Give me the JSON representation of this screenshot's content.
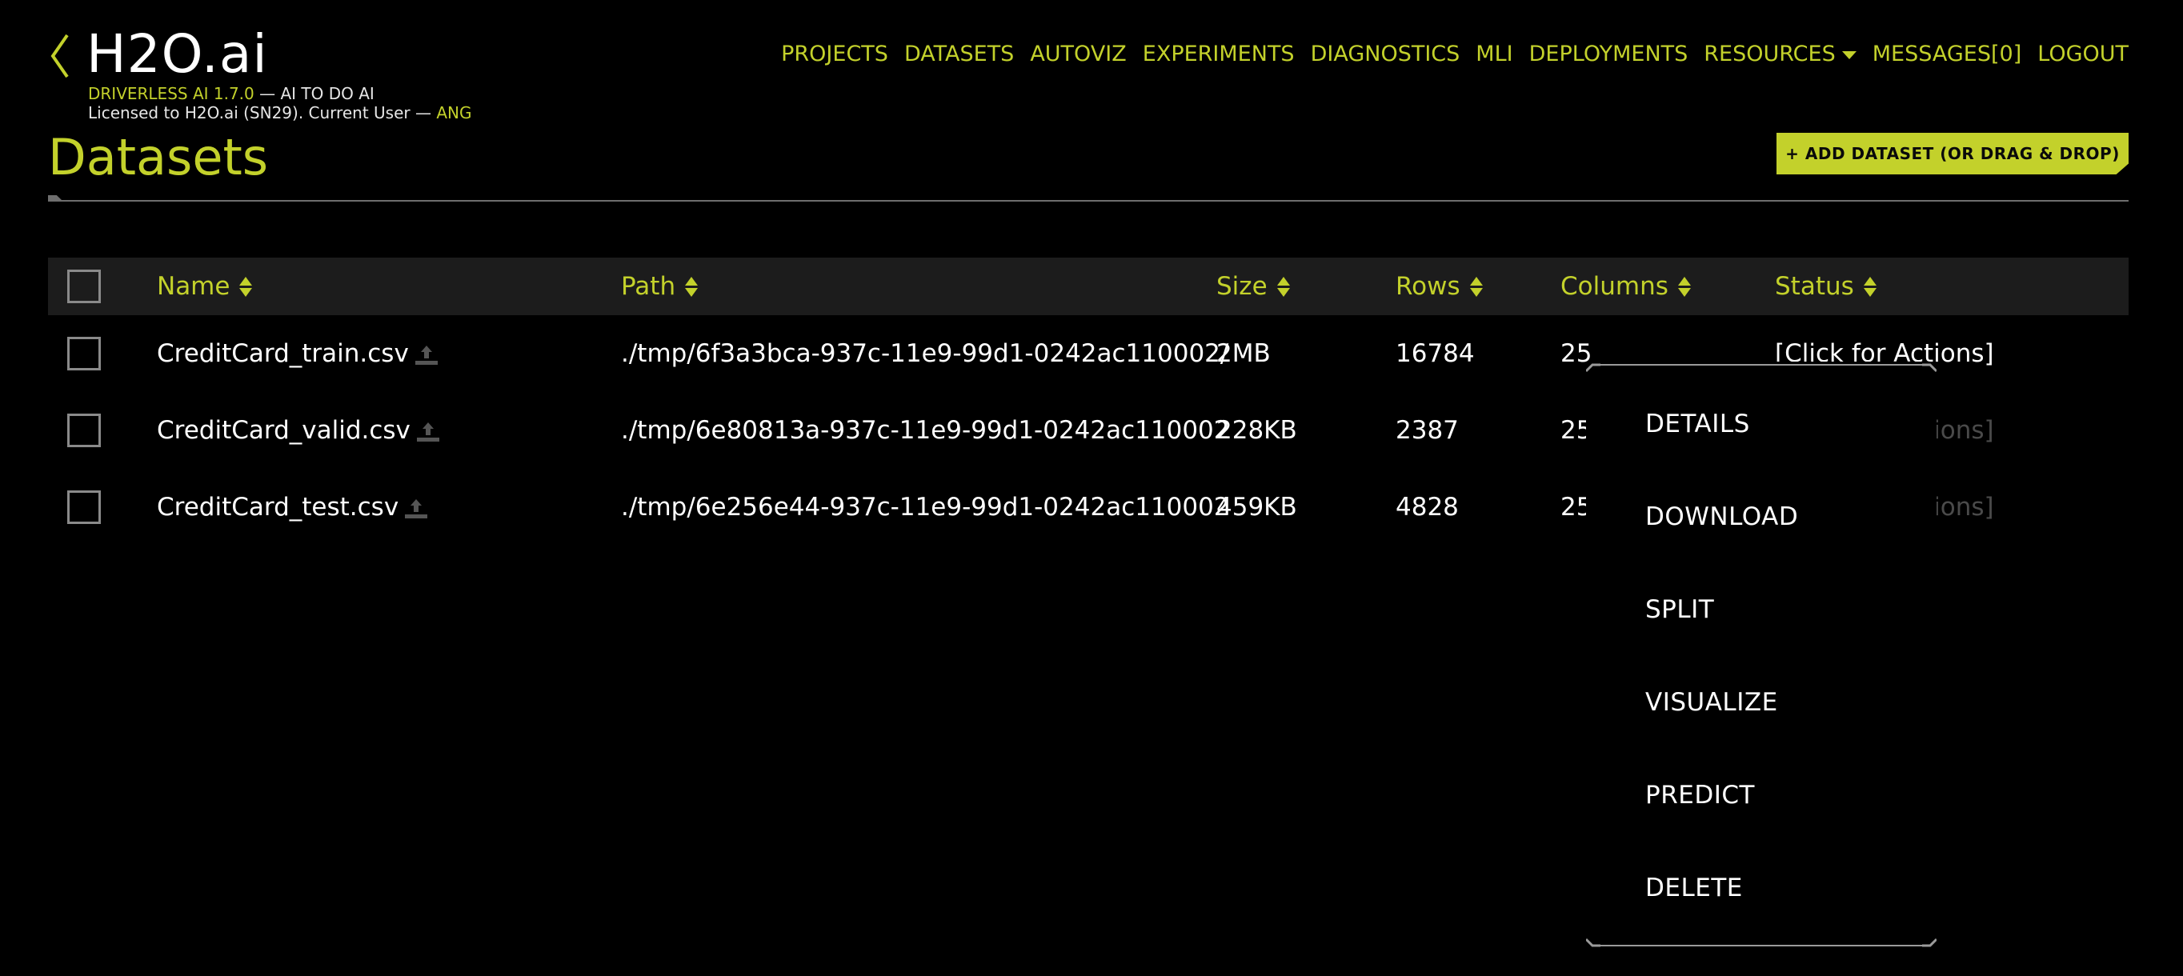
{
  "header": {
    "logo_text": "H2O.ai",
    "product_name": "DRIVERLESS AI 1.7.0",
    "tagline": " — AI TO DO AI",
    "license_text": "Licensed to H2O.ai (SN29). Current User — ",
    "current_user": "ANG"
  },
  "nav": {
    "projects": "PROJECTS",
    "datasets": "DATASETS",
    "autoviz": "AUTOVIZ",
    "experiments": "EXPERIMENTS",
    "diagnostics": "DIAGNOSTICS",
    "mli": "MLI",
    "deployments": "DEPLOYMENTS",
    "resources": "RESOURCES",
    "messages": "MESSAGES[0]",
    "logout": "LOGOUT"
  },
  "page": {
    "title": "Datasets",
    "add_button": "+ ADD DATASET (OR DRAG & DROP)"
  },
  "table": {
    "headers": {
      "name": "Name",
      "path": "Path",
      "size": "Size",
      "rows": "Rows",
      "columns": "Columns",
      "status": "Status"
    },
    "rows": [
      {
        "name": "CreditCard_train.csv",
        "path": "./tmp/6f3a3bca-937c-11e9-99d1-0242ac110002/...",
        "size": "2MB",
        "rows": "16784",
        "columns": "25",
        "status": "[Click for Actions]"
      },
      {
        "name": "CreditCard_valid.csv",
        "path": "./tmp/6e80813a-937c-11e9-99d1-0242ac110002...",
        "size": "228KB",
        "rows": "2387",
        "columns": "25",
        "status": "[Click for Actions]"
      },
      {
        "name": "CreditCard_test.csv",
        "path": "./tmp/6e256e44-937c-11e9-99d1-0242ac110002...",
        "size": "459KB",
        "rows": "4828",
        "columns": "25",
        "status": "[Click for Actions]"
      }
    ]
  },
  "action_menu": {
    "items": [
      "DETAILS",
      "DOWNLOAD",
      "SPLIT",
      "VISUALIZE",
      "PREDICT",
      "DELETE"
    ]
  },
  "colors": {
    "accent": "#c3d12b",
    "background": "#000000",
    "header_row": "#1c1c1c",
    "text": "#ffffff"
  },
  "icons": {
    "back": "chevron-left-icon",
    "sort": "sort-arrows-icon",
    "upload": "upload-icon",
    "dropdown": "caret-down-icon"
  }
}
